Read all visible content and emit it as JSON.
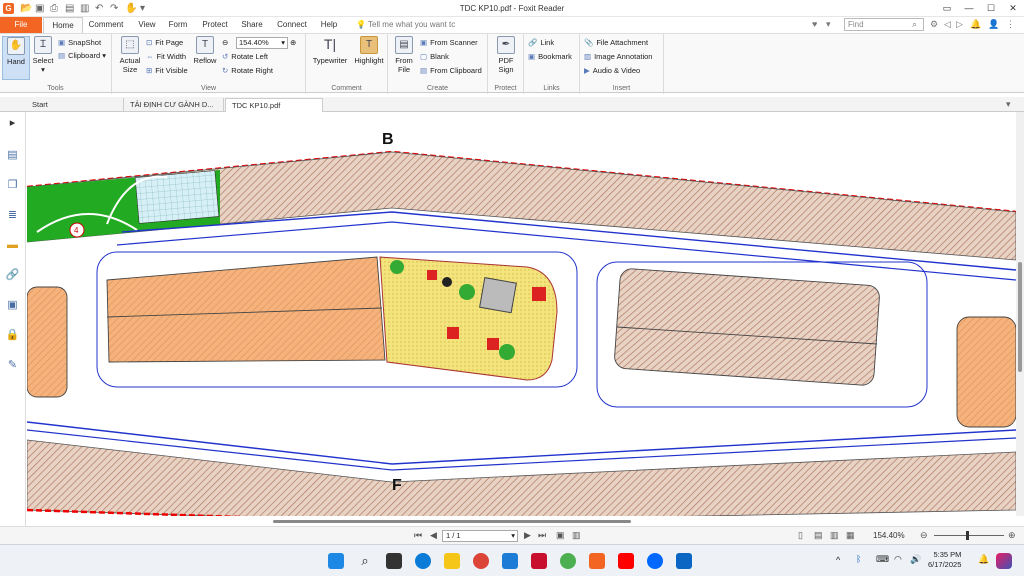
{
  "window": {
    "title": "TDC KP10.pdf - Foxit Reader",
    "logo": "G"
  },
  "tabs": [
    "File",
    "Home",
    "Comment",
    "View",
    "Form",
    "Protect",
    "Share",
    "Connect",
    "Help"
  ],
  "tellme": "Tell me what you want tc",
  "find_placeholder": "Find",
  "ribbon": {
    "tools": {
      "hand": "Hand",
      "select": "Select",
      "snapshot": "SnapShot",
      "clipboard": "Clipboard",
      "label": "Tools"
    },
    "view": {
      "actual": "Actual Size",
      "fitpage": "Fit Page",
      "fitwidth": "Fit Width",
      "fitvisible": "Fit Visible",
      "reflow": "Reflow",
      "zoom": "154.40%",
      "rotleft": "Rotate Left",
      "rotright": "Rotate Right",
      "label": "View"
    },
    "comment": {
      "typewriter": "Typewriter",
      "highlight": "Highlight",
      "label": "Comment"
    },
    "create": {
      "fromfile": "From File",
      "scanner": "From Scanner",
      "blank": "Blank",
      "clipboard": "From Clipboard",
      "label": "Create"
    },
    "protect": {
      "pdfsign": "PDF Sign",
      "label": "Protect"
    },
    "links": {
      "link": "Link",
      "bookmark": "Bookmark",
      "label": "Links"
    },
    "insert": {
      "file": "File Attachment",
      "image": "Image Annotation",
      "audio": "Audio & Video",
      "label": "Insert"
    }
  },
  "doctabs": [
    "Start",
    "TẢI ĐỊNH CƯ GÀNH D...",
    "TDC KP10.pdf"
  ],
  "map": {
    "label_b": "B",
    "label_f": "F",
    "circle_4": "4"
  },
  "status": {
    "page": "1 / 1",
    "zoom": "154.40%"
  },
  "clock": {
    "time": "5:35 PM",
    "date": "6/17/2025"
  },
  "colors": {
    "brand": "#f26522",
    "lot_orange": "#f4b183",
    "lot_hatch": "#c9a18b",
    "park_green": "#22aa22",
    "park_yellow": "#f2e37a"
  }
}
